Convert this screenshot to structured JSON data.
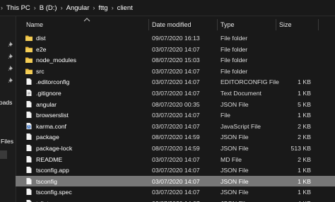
{
  "breadcrumb": {
    "items": [
      "This PC",
      "B (D:)",
      "Angular",
      "fttg",
      "client"
    ]
  },
  "nav": {
    "labels": [
      "loads",
      "Files"
    ]
  },
  "columns": {
    "name": "Name",
    "date": "Date modified",
    "type": "Type",
    "size": "Size"
  },
  "files": [
    {
      "name": "dist",
      "date": "09/07/2020 16:13",
      "type": "File folder",
      "size": "",
      "icon": "folder-icon"
    },
    {
      "name": "e2e",
      "date": "03/07/2020 14:07",
      "type": "File folder",
      "size": "",
      "icon": "folder-icon"
    },
    {
      "name": "node_modules",
      "date": "08/07/2020 15:03",
      "type": "File folder",
      "size": "",
      "icon": "folder-icon"
    },
    {
      "name": "src",
      "date": "03/07/2020 14:07",
      "type": "File folder",
      "size": "",
      "icon": "folder-icon"
    },
    {
      "name": ".editorconfig",
      "date": "03/07/2020 14:07",
      "type": "EDITORCONFIG File",
      "size": "1 KB",
      "icon": "file-icon"
    },
    {
      "name": ".gitignore",
      "date": "03/07/2020 14:07",
      "type": "Text Document",
      "size": "1 KB",
      "icon": "text-file-icon"
    },
    {
      "name": "angular",
      "date": "08/07/2020 00:35",
      "type": "JSON File",
      "size": "5 KB",
      "icon": "file-icon"
    },
    {
      "name": "browserslist",
      "date": "03/07/2020 14:07",
      "type": "File",
      "size": "1 KB",
      "icon": "file-icon"
    },
    {
      "name": "karma.conf",
      "date": "03/07/2020 14:07",
      "type": "JavaScript File",
      "size": "2 KB",
      "icon": "js-file-icon"
    },
    {
      "name": "package",
      "date": "08/07/2020 14:59",
      "type": "JSON File",
      "size": "2 KB",
      "icon": "file-icon"
    },
    {
      "name": "package-lock",
      "date": "08/07/2020 14:59",
      "type": "JSON File",
      "size": "513 KB",
      "icon": "file-icon"
    },
    {
      "name": "README",
      "date": "03/07/2020 14:07",
      "type": "MD File",
      "size": "2 KB",
      "icon": "file-icon"
    },
    {
      "name": "tsconfig.app",
      "date": "03/07/2020 14:07",
      "type": "JSON File",
      "size": "1 KB",
      "icon": "file-icon"
    },
    {
      "name": "tsconfig",
      "date": "03/07/2020 14:07",
      "type": "JSON File",
      "size": "1 KB",
      "icon": "file-icon",
      "selected": true
    },
    {
      "name": "tsconfig.spec",
      "date": "03/07/2020 14:07",
      "type": "JSON File",
      "size": "1 KB",
      "icon": "file-icon"
    },
    {
      "name": "tslint",
      "date": "03/07/2020 14:07",
      "type": "JSON File",
      "size": "4 KB",
      "icon": "file-icon"
    }
  ],
  "colors": {
    "background": "#191919",
    "selected_row": "#777777",
    "folder": "#e8b83a"
  }
}
